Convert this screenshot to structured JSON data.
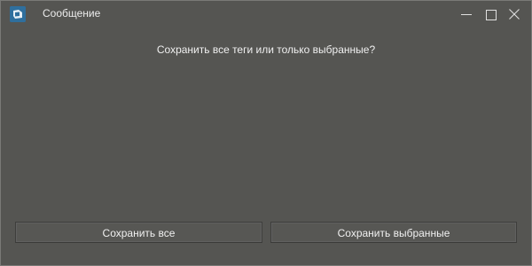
{
  "window": {
    "title": "Сообщение"
  },
  "message": {
    "text": "Сохранить все теги или только выбранные?"
  },
  "buttons": {
    "save_all_label": "Сохранить все",
    "save_selected_label": "Сохранить выбранные"
  },
  "colors": {
    "background": "#555552",
    "text": "#f0f0f0",
    "app_icon": "#2f6f9d"
  },
  "icons": {
    "app": "app-icon",
    "minimize": "minimize-icon",
    "maximize": "maximize-icon",
    "close": "close-icon"
  }
}
